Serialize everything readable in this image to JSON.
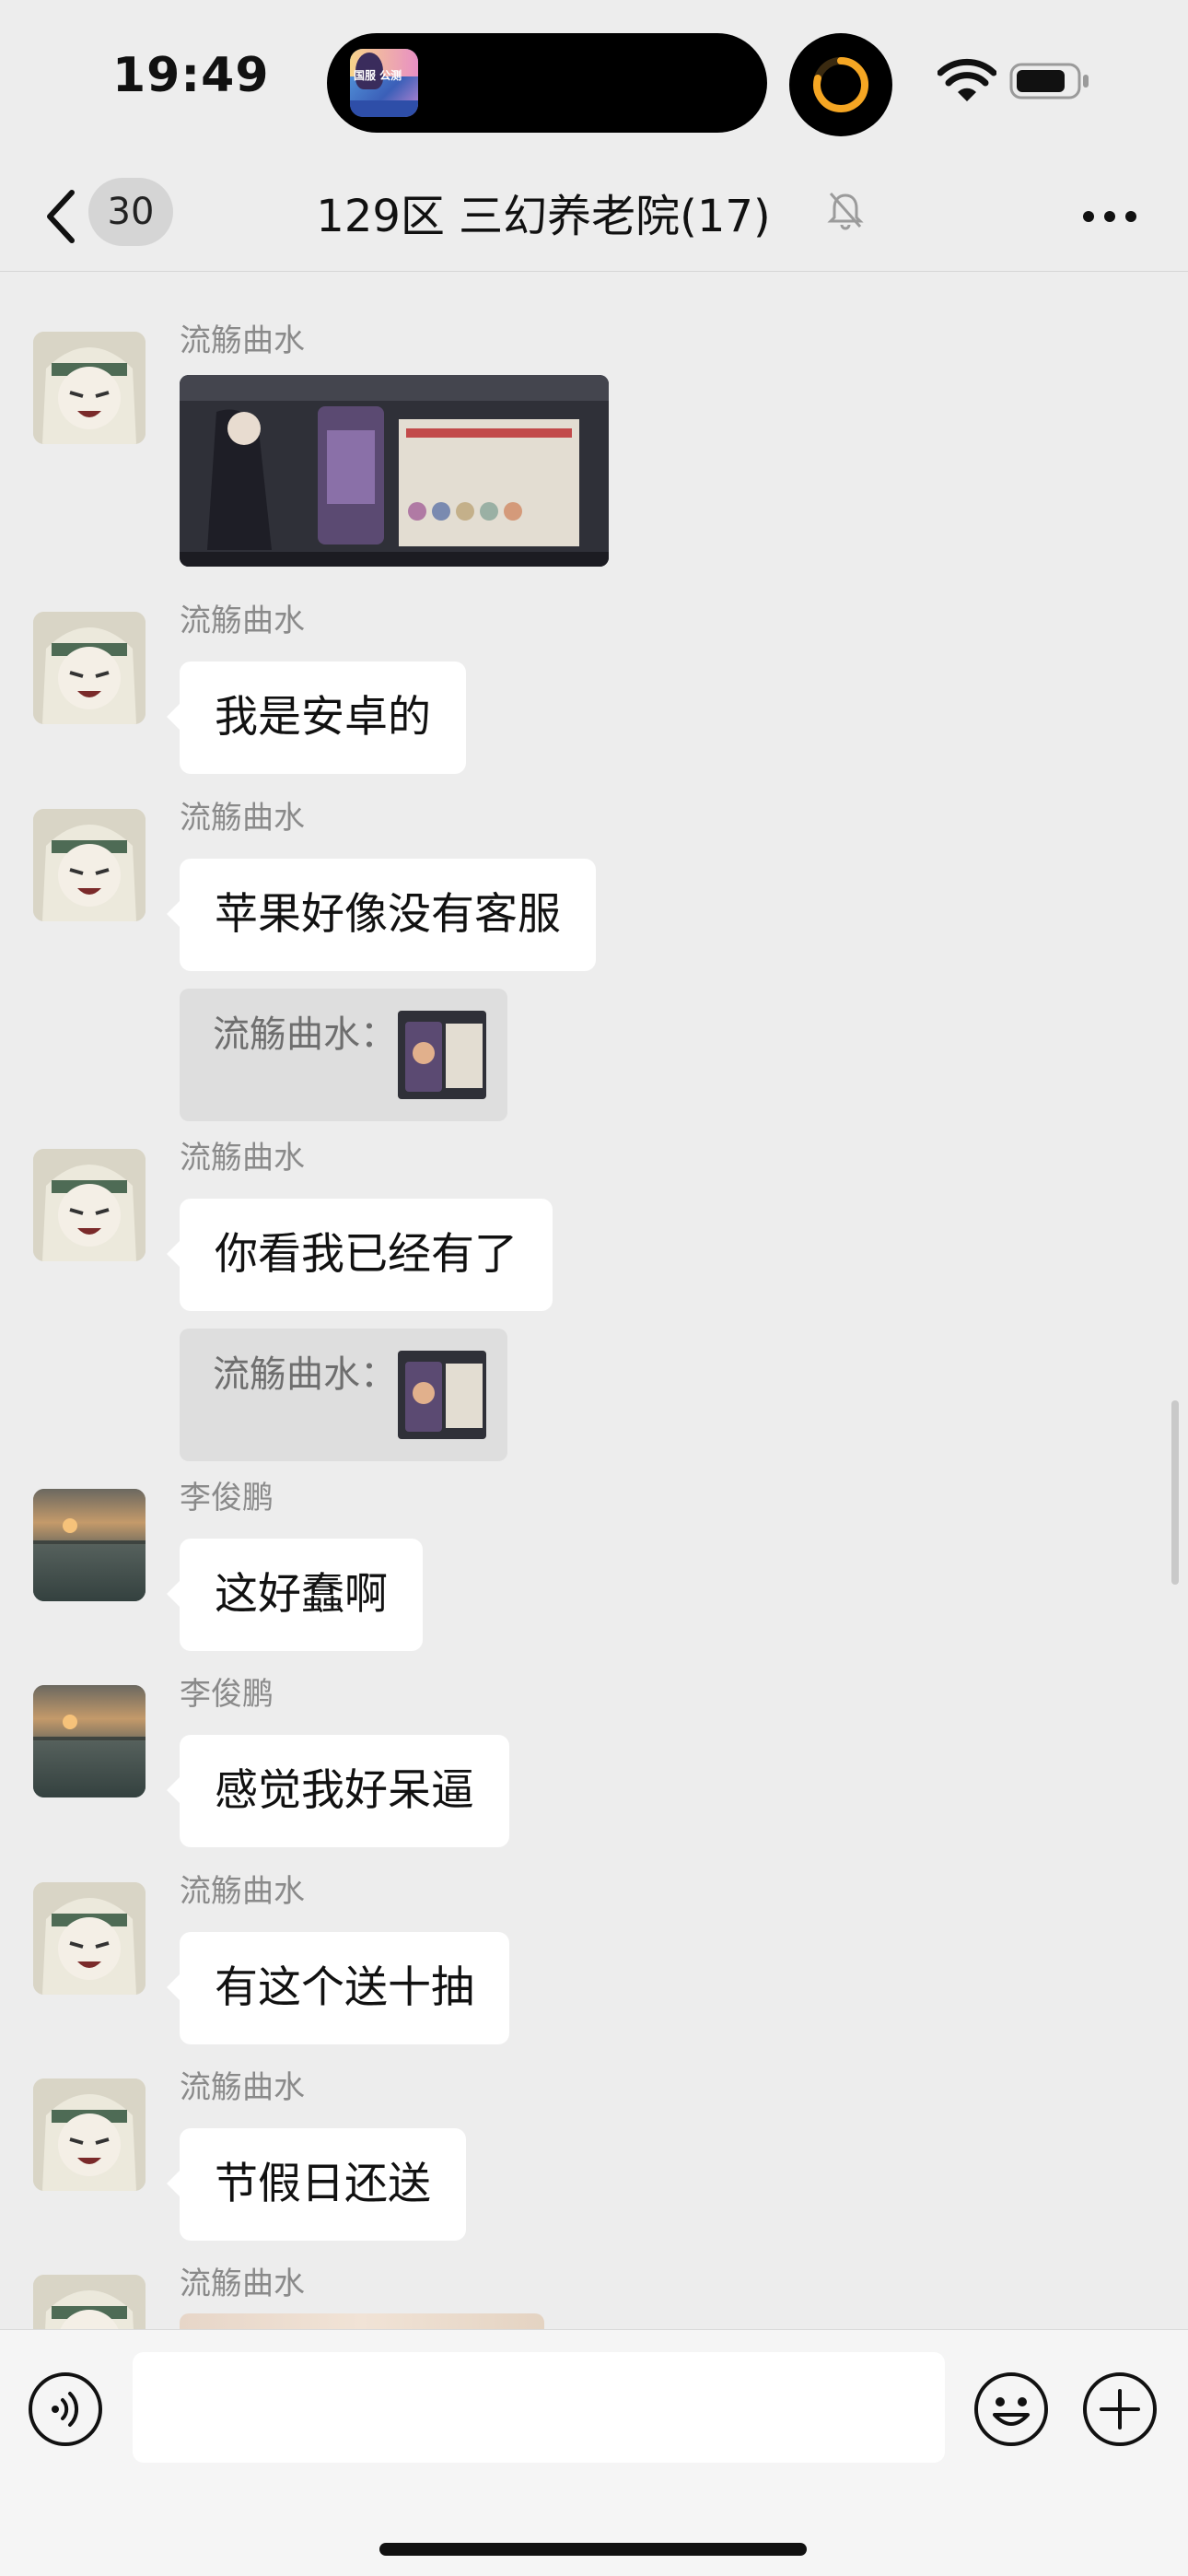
{
  "status_bar": {
    "time": "19:49",
    "island_app_text": "国服 公测",
    "colors": {
      "timer_ring": "#f5a623"
    }
  },
  "header": {
    "back_icon": "chevron-left-icon",
    "unread_count": "30",
    "title": "129区 三幻养老院(17)",
    "mute_icon": "bell-slash-icon",
    "more_icon": "ellipsis-icon"
  },
  "messages": [
    {
      "sender": "流觞曲水",
      "type": "image",
      "avatar": "anime-girl"
    },
    {
      "sender": "流觞曲水",
      "type": "text",
      "text": "我是安卓的",
      "avatar": "anime-girl"
    },
    {
      "sender": "流觞曲水",
      "type": "text",
      "text": "苹果好像没有客服",
      "avatar": "anime-girl",
      "quote": "流觞曲水："
    },
    {
      "sender": "流觞曲水",
      "type": "text",
      "text": "你看我已经有了",
      "avatar": "anime-girl",
      "quote": "流觞曲水："
    },
    {
      "sender": "李俊鹏",
      "type": "text",
      "text": "这好蠢啊",
      "avatar": "lake-sunset"
    },
    {
      "sender": "李俊鹏",
      "type": "text",
      "text": "感觉我好呆逼",
      "avatar": "lake-sunset"
    },
    {
      "sender": "流觞曲水",
      "type": "text",
      "text": "有这个送十抽",
      "avatar": "anime-girl"
    },
    {
      "sender": "流觞曲水",
      "type": "text",
      "text": "节假日还送",
      "avatar": "anime-girl"
    },
    {
      "sender": "流觞曲水",
      "type": "image",
      "avatar": "anime-girl"
    }
  ],
  "input_bar": {
    "voice_icon": "voice-icon",
    "text_value": "",
    "emoji_icon": "emoji-icon",
    "plus_icon": "plus-circle-icon"
  }
}
